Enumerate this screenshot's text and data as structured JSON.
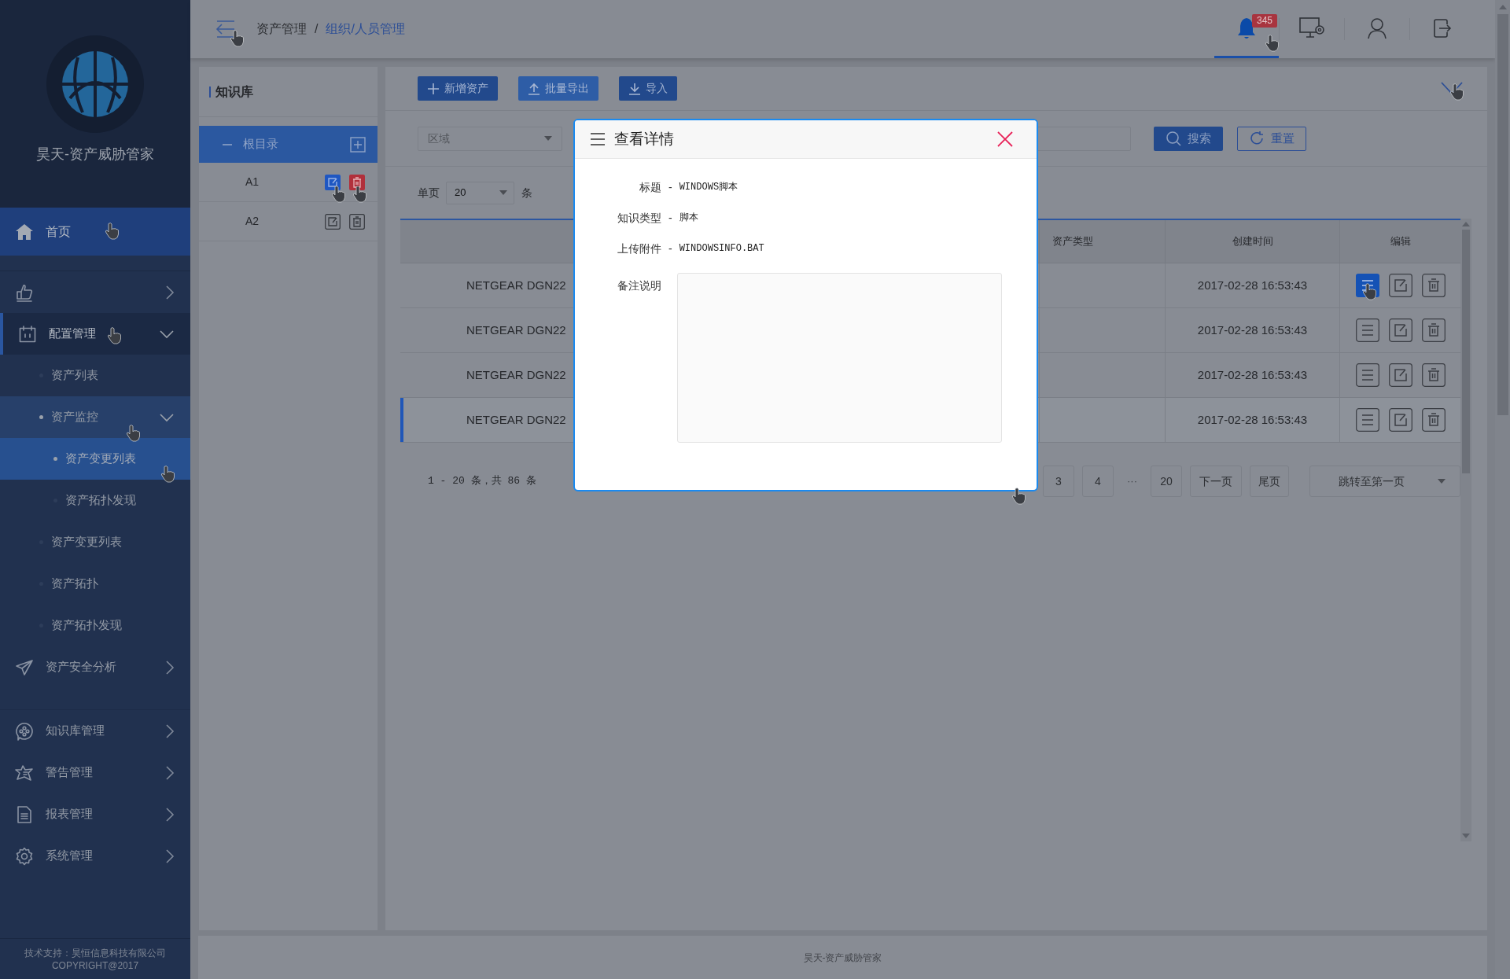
{
  "sidebar": {
    "brand": "昊天-资产威胁管家",
    "menu": [
      {
        "kind": "item",
        "label": "首页",
        "selected": true
      },
      {
        "kind": "group",
        "expanded": false,
        "selected": false
      },
      {
        "kind": "group",
        "label": "配置管理",
        "expanded": true,
        "selected": false,
        "children": [
          {
            "kind": "item",
            "label": "资产列表",
            "selected": false
          },
          {
            "kind": "group",
            "label": "资产监控",
            "expanded": true,
            "selected": false,
            "children": [
              {
                "kind": "item",
                "label": "资产变更列表",
                "selected": true
              },
              {
                "kind": "item",
                "label": "资产拓扑发现",
                "selected": false
              }
            ]
          },
          {
            "kind": "item",
            "label": "资产变更列表",
            "selected": false
          },
          {
            "kind": "item",
            "label": "资产拓扑",
            "selected": false
          },
          {
            "kind": "item",
            "label": "资产拓扑发现",
            "selected": false
          }
        ]
      },
      {
        "kind": "group",
        "label": "资产安全分析",
        "expanded": false,
        "selected": false
      },
      {
        "kind": "group",
        "label": "知识库管理",
        "expanded": false,
        "selected": false
      },
      {
        "kind": "group",
        "label": "警告管理",
        "expanded": false,
        "selected": false
      },
      {
        "kind": "group",
        "label": "报表管理",
        "expanded": false,
        "selected": false
      },
      {
        "kind": "group",
        "label": "系统管理",
        "expanded": false,
        "selected": false
      }
    ],
    "footer": [
      "技术支持：昊恒信息科技有限公司",
      "COPYRIGHT@2017"
    ]
  },
  "topbar": {
    "breadcrumb": [
      {
        "label": "资产管理",
        "selected": false
      },
      {
        "label": "组织/人员管理",
        "selected": true
      }
    ],
    "breadcrumb_separator": "/",
    "icons": [
      {
        "kind": "bell",
        "selected": true,
        "badge": "345"
      },
      {
        "kind": "monitor",
        "selected": false
      },
      {
        "kind": "user",
        "selected": false
      },
      {
        "kind": "logout",
        "selected": false
      }
    ]
  },
  "tree": {
    "title": "知识库",
    "root": {
      "label": "根目录",
      "expanded": true,
      "selected": true,
      "children": [
        {
          "label": "A1",
          "selected": true
        },
        {
          "label": "A2",
          "selected": false
        }
      ]
    }
  },
  "toolbar": [
    {
      "kind": "add",
      "label": "新增资产"
    },
    {
      "kind": "export",
      "label": "批量导出"
    },
    {
      "kind": "import",
      "label": "导入"
    }
  ],
  "filters": {
    "region": {
      "placeholder": "区域"
    },
    "search": "搜索",
    "reset": "重置"
  },
  "page_size": {
    "label": "单页",
    "value": "20",
    "unit": "条"
  },
  "table": {
    "columns": [
      "资产类型",
      "创建时间",
      "编辑"
    ],
    "rows": [
      {
        "column_1": "NETGEAR DGN22",
        "created": "2017-02-28 16:53:43",
        "selected": false,
        "view_highlighted": true
      },
      {
        "column_1": "NETGEAR DGN22",
        "created": "2017-02-28 16:53:43",
        "selected": false,
        "view_highlighted": false
      },
      {
        "column_1": "NETGEAR DGN22",
        "created": "2017-02-28 16:53:43",
        "selected": false,
        "view_highlighted": false
      },
      {
        "column_1": "NETGEAR DGN22",
        "created": "2017-02-28 16:53:43",
        "selected": true,
        "view_highlighted": false
      }
    ]
  },
  "pagination": {
    "summary": "1 - 20 条，共 86 条",
    "pages": [
      "3",
      "4"
    ],
    "ellipsis": "···",
    "last_page": "20",
    "next": "下一页",
    "end": "尾页",
    "jump": "跳转至第一页"
  },
  "modal": {
    "title": "查看详情",
    "fields": [
      {
        "label": "标题",
        "separator": "-",
        "value": "WINDOWS脚本"
      },
      {
        "label": "知识类型",
        "separator": "-",
        "value": "脚本"
      },
      {
        "label": "上传附件",
        "separator": "-",
        "value": "WINDOWSINFO.BAT"
      }
    ],
    "notes_label": "备注说明"
  },
  "footer": "昊天-资产威胁管家"
}
